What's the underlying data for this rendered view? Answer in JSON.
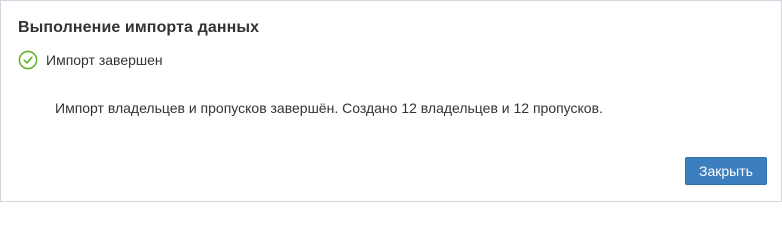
{
  "dialog": {
    "title": "Выполнение импорта данных",
    "status": {
      "icon": "check-circle-icon",
      "text": "Импорт завершен",
      "color": "#6ab42d"
    },
    "message": "Импорт владельцев и пропусков завершён. Создано 12 владельцев и 12 пропусков.",
    "close_label": "Закрыть",
    "accent_color": "#3c7fbf"
  }
}
